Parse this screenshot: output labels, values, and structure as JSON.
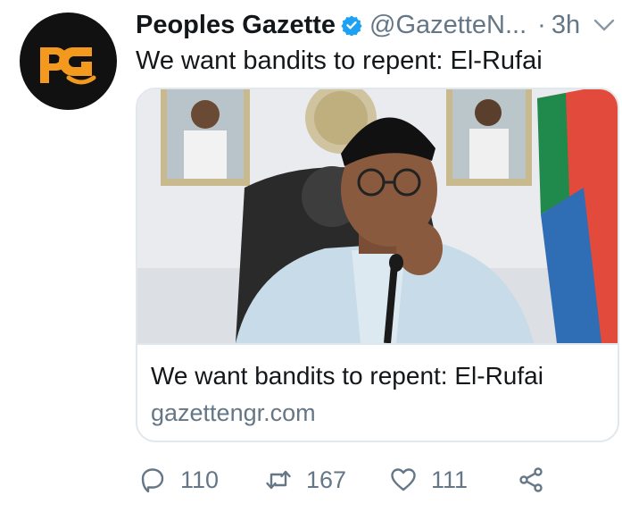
{
  "tweet": {
    "author": {
      "display_name": "Peoples Gazette",
      "handle": "@GazetteN...",
      "avatar_text": "pg",
      "verified": true
    },
    "separator": "·",
    "time": "3h",
    "text": "We want bandits to repent: El-Rufai",
    "card": {
      "title": "We want bandits to repent: El-Rufai",
      "domain": "gazettengr.com",
      "image_description_icon": "photo-icon"
    },
    "actions": {
      "replies": "110",
      "retweets": "167",
      "likes": "111"
    }
  },
  "colors": {
    "text_primary": "#14171a",
    "text_secondary": "#657786",
    "verified_blue": "#1da1f2",
    "border": "#e1e8ed",
    "avatar_bg": "#111111",
    "avatar_logo": "#f39a1e"
  }
}
